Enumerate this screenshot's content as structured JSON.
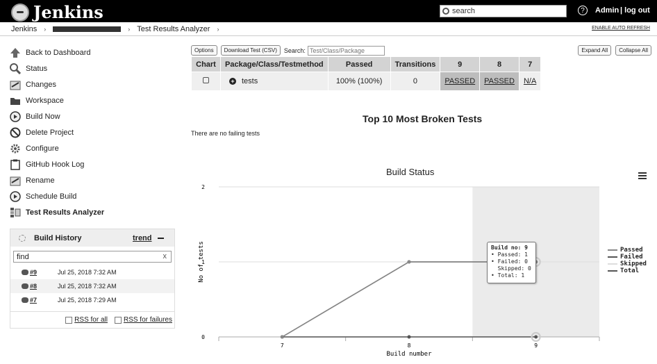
{
  "header": {
    "app_name": "Jenkins",
    "search_placeholder": "search",
    "help_icon": "help-icon",
    "user": "Admin",
    "logout": "log out"
  },
  "breadcrumb": {
    "root": "Jenkins",
    "current": "Test Results Analyzer",
    "enable_refresh": "ENABLE AUTO REFRESH"
  },
  "sidebar": {
    "items": [
      {
        "label": "Back to Dashboard",
        "icon": "up-arrow-icon"
      },
      {
        "label": "Status",
        "icon": "magnifier-icon"
      },
      {
        "label": "Changes",
        "icon": "notepad-icon"
      },
      {
        "label": "Workspace",
        "icon": "folder-icon"
      },
      {
        "label": "Build Now",
        "icon": "clock-icon"
      },
      {
        "label": "Delete Project",
        "icon": "no-entry-icon"
      },
      {
        "label": "Configure",
        "icon": "gear-icon"
      },
      {
        "label": "GitHub Hook Log",
        "icon": "clipboard-icon"
      },
      {
        "label": "Rename",
        "icon": "notepad-icon"
      },
      {
        "label": "Schedule Build",
        "icon": "clock-icon"
      },
      {
        "label": "Test Results Analyzer",
        "icon": "analyzer-icon"
      }
    ]
  },
  "build_history": {
    "title": "Build History",
    "trend": "trend",
    "find_value": "find",
    "builds": [
      {
        "number": "#9",
        "date": "Jul 25, 2018 7:32 AM"
      },
      {
        "number": "#8",
        "date": "Jul 25, 2018 7:32 AM"
      },
      {
        "number": "#7",
        "date": "Jul 25, 2018 7:29 AM"
      }
    ],
    "rss_all": "RSS for all",
    "rss_failures": "RSS for failures"
  },
  "toolbar": {
    "options": "Options",
    "download": "Download Test (CSV)",
    "search_label": "Search:",
    "search_placeholder": "Test/Class/Package",
    "expand_all": "Expand All",
    "collapse_all": "Collapse All"
  },
  "results_table": {
    "headers": [
      "Chart",
      "Package/Class/Testmethod",
      "Passed",
      "Transitions",
      "9",
      "8",
      "7"
    ],
    "row": {
      "name": "tests",
      "passed": "100% (100%)",
      "transitions": "0",
      "build_9": "PASSED",
      "build_8": "PASSED",
      "build_7": "N/A"
    }
  },
  "broken_tests": {
    "title": "Top 10 Most Broken Tests",
    "message": "There are no failing tests"
  },
  "chart_data": {
    "type": "line",
    "title": "Build Status",
    "xlabel": "Build number",
    "ylabel": "No of tests",
    "categories": [
      "7",
      "8",
      "9"
    ],
    "yticks": [
      "0",
      "1",
      "2"
    ],
    "ylim": [
      0,
      2
    ],
    "series": [
      {
        "name": "Passed",
        "values": [
          0,
          1,
          1
        ],
        "color": "#888888"
      },
      {
        "name": "Failed",
        "values": [
          0,
          0,
          0
        ],
        "color": "#555555"
      },
      {
        "name": "Skipped",
        "values": [
          0,
          0,
          0
        ],
        "color": "#dddddd"
      },
      {
        "name": "Total",
        "values": [
          0,
          1,
          1
        ],
        "color": "#555555"
      }
    ],
    "highlight_category": "9",
    "tooltip": {
      "title": "Build no: 9",
      "passed": "Passed: 1",
      "failed": "Failed: 0",
      "skipped": "Skipped: 0",
      "total": "Total: 1"
    }
  }
}
